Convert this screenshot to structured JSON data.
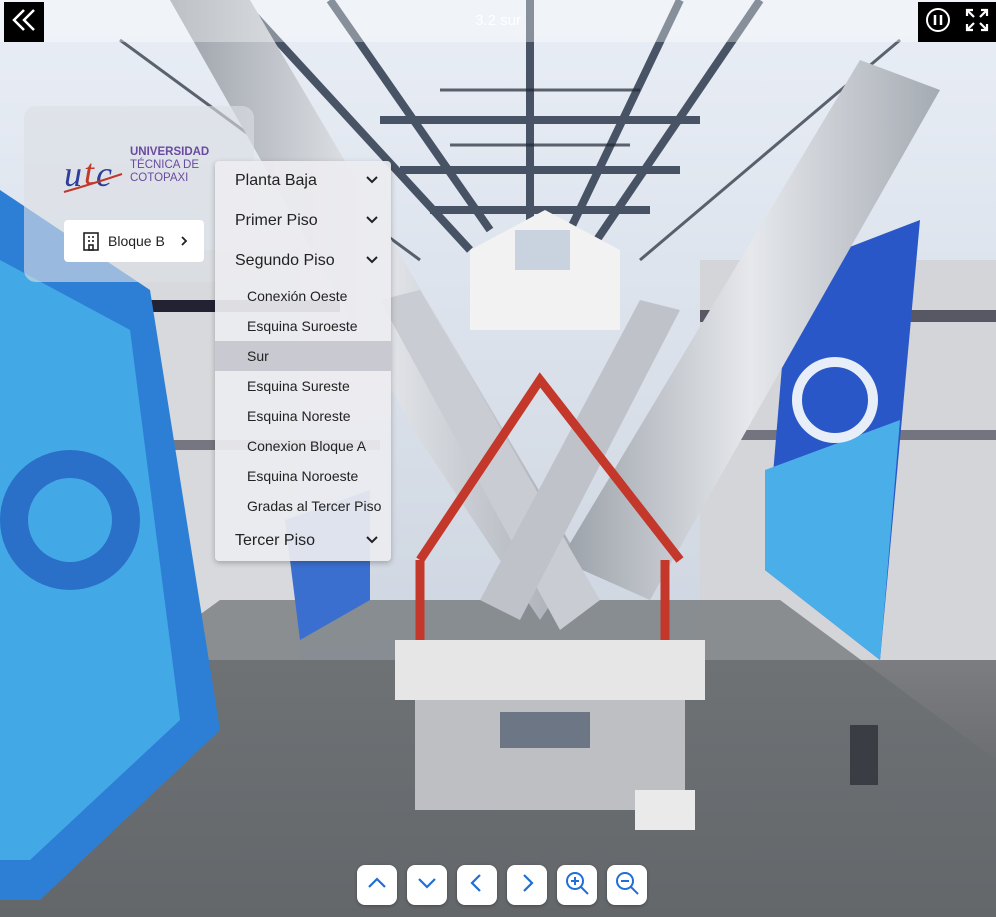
{
  "scene": {
    "title": "3.2 sur"
  },
  "logo": {
    "line1": "UNIVERSIDAD",
    "line2": "TÉCNICA DE",
    "line3": "COTOPAXI",
    "mark": "utc"
  },
  "block_button": {
    "label": "Bloque B",
    "icon": "building-icon"
  },
  "floors": [
    {
      "label": "Planta Baja",
      "expanded": false
    },
    {
      "label": "Primer Piso",
      "expanded": false
    },
    {
      "label": "Segundo Piso",
      "expanded": true,
      "items": [
        {
          "label": "Conexión Oeste",
          "active": false
        },
        {
          "label": "Esquina Suroeste",
          "active": false
        },
        {
          "label": "Sur",
          "active": true
        },
        {
          "label": "Esquina Sureste",
          "active": false
        },
        {
          "label": "Esquina Noreste",
          "active": false
        },
        {
          "label": "Conexion Bloque A",
          "active": false
        },
        {
          "label": "Esquina Noroeste",
          "active": false
        },
        {
          "label": "Gradas al Tercer Piso",
          "active": false
        }
      ]
    },
    {
      "label": "Tercer Piso",
      "expanded": false
    }
  ],
  "controls": [
    "up-icon",
    "down-icon",
    "left-icon",
    "right-icon",
    "zoom-in-icon",
    "zoom-out-icon"
  ],
  "colors": {
    "accent": "#1f6fd6",
    "banner_blue": "#2a57c8",
    "banner_light": "#5bb6ea"
  }
}
